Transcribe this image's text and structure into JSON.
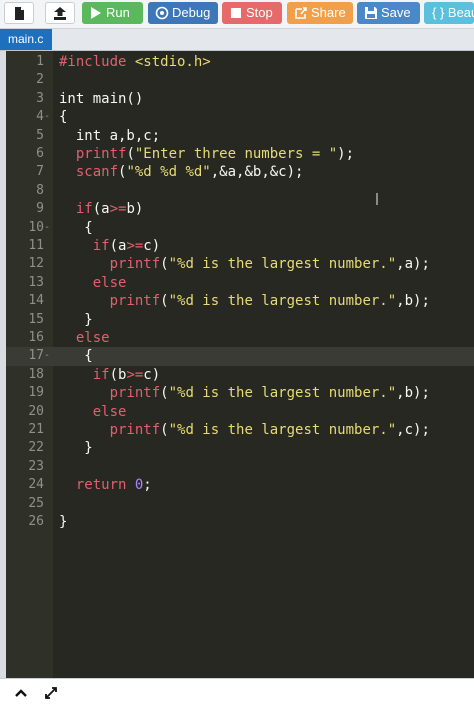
{
  "toolbar": {
    "run": "Run",
    "debug": "Debug",
    "stop": "Stop",
    "share": "Share",
    "save": "Save",
    "beautify": "{ } Beau",
    "colors": {
      "run": "#5cb85c",
      "debug": "#3d77b9",
      "stop": "#e66a6a",
      "share": "#f0a04b",
      "save": "#4a88c7",
      "beautify": "#5bc0de"
    }
  },
  "tabs": [
    {
      "label": "main.c",
      "active": true
    }
  ],
  "editor": {
    "lines": [
      {
        "n": "1",
        "fold": "",
        "tokens": [
          [
            "k",
            "#include "
          ],
          [
            "s",
            "<stdio.h>"
          ]
        ]
      },
      {
        "n": "2",
        "fold": "",
        "tokens": []
      },
      {
        "n": "3",
        "fold": "",
        "tokens": [
          [
            "",
            "int main()"
          ]
        ]
      },
      {
        "n": "4",
        "fold": "-",
        "tokens": [
          [
            "",
            "{"
          ]
        ]
      },
      {
        "n": "5",
        "fold": "",
        "tokens": [
          [
            "",
            "  int a,b,c;"
          ]
        ]
      },
      {
        "n": "6",
        "fold": "",
        "tokens": [
          [
            "k",
            "  printf"
          ],
          [
            "",
            "("
          ],
          [
            "s",
            "\"Enter three numbers = \""
          ],
          [
            "",
            ");"
          ]
        ]
      },
      {
        "n": "7",
        "fold": "",
        "tokens": [
          [
            "k",
            "  scanf"
          ],
          [
            "",
            "("
          ],
          [
            "s",
            "\"%d %d %d\""
          ],
          [
            "",
            ",&a,&b,&c);"
          ]
        ]
      },
      {
        "n": "8",
        "fold": "",
        "tokens": []
      },
      {
        "n": "9",
        "fold": "",
        "tokens": [
          [
            "k",
            "  if"
          ],
          [
            "",
            "(a"
          ],
          [
            "k",
            ">="
          ],
          [
            "",
            "b)"
          ]
        ]
      },
      {
        "n": "10",
        "fold": "-",
        "tokens": [
          [
            "",
            "   {"
          ]
        ]
      },
      {
        "n": "11",
        "fold": "",
        "tokens": [
          [
            "k",
            "    if"
          ],
          [
            "",
            "(a"
          ],
          [
            "k",
            ">="
          ],
          [
            "",
            "c)"
          ]
        ]
      },
      {
        "n": "12",
        "fold": "",
        "tokens": [
          [
            "k",
            "      printf"
          ],
          [
            "",
            "("
          ],
          [
            "s",
            "\"%d is the largest number.\""
          ],
          [
            "",
            ",a);"
          ]
        ]
      },
      {
        "n": "13",
        "fold": "",
        "tokens": [
          [
            "k",
            "    else"
          ]
        ]
      },
      {
        "n": "14",
        "fold": "",
        "tokens": [
          [
            "k",
            "      printf"
          ],
          [
            "",
            "("
          ],
          [
            "s",
            "\"%d is the largest number.\""
          ],
          [
            "",
            ",b);"
          ]
        ]
      },
      {
        "n": "15",
        "fold": "",
        "tokens": [
          [
            "",
            "   }"
          ]
        ]
      },
      {
        "n": "16",
        "fold": "",
        "tokens": [
          [
            "k",
            "  else"
          ]
        ]
      },
      {
        "n": "17",
        "fold": "-",
        "tokens": [
          [
            "",
            "   {"
          ]
        ],
        "active": true
      },
      {
        "n": "18",
        "fold": "",
        "tokens": [
          [
            "k",
            "    if"
          ],
          [
            "",
            "(b"
          ],
          [
            "k",
            ">="
          ],
          [
            "",
            "c)"
          ]
        ]
      },
      {
        "n": "19",
        "fold": "",
        "tokens": [
          [
            "k",
            "      printf"
          ],
          [
            "",
            "("
          ],
          [
            "s",
            "\"%d is the largest number.\""
          ],
          [
            "",
            ",b);"
          ]
        ]
      },
      {
        "n": "20",
        "fold": "",
        "tokens": [
          [
            "k",
            "    else"
          ]
        ]
      },
      {
        "n": "21",
        "fold": "",
        "tokens": [
          [
            "k",
            "      printf"
          ],
          [
            "",
            "("
          ],
          [
            "s",
            "\"%d is the largest number.\""
          ],
          [
            "",
            ",c);"
          ]
        ]
      },
      {
        "n": "22",
        "fold": "",
        "tokens": [
          [
            "",
            "   }"
          ]
        ]
      },
      {
        "n": "23",
        "fold": "",
        "tokens": []
      },
      {
        "n": "24",
        "fold": "",
        "tokens": [
          [
            "k",
            "  return "
          ],
          [
            "n",
            "0"
          ],
          [
            "",
            ";"
          ]
        ]
      },
      {
        "n": "25",
        "fold": "",
        "tokens": []
      },
      {
        "n": "26",
        "fold": "",
        "tokens": [
          [
            "",
            "}"
          ]
        ]
      }
    ]
  },
  "icons": {
    "new_file": "file-icon",
    "upload": "upload-icon",
    "run": "play-icon",
    "debug": "debug-icon",
    "stop": "stop-icon",
    "share": "share-icon",
    "save": "save-icon",
    "collapse": "chevron-up-icon",
    "expand": "expand-arrows-icon"
  }
}
